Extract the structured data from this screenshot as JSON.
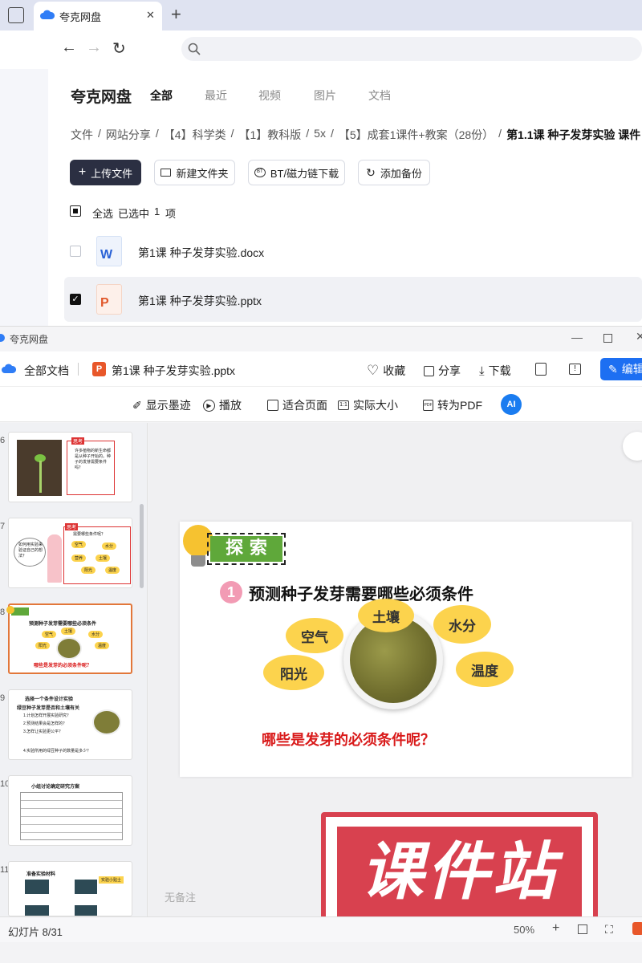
{
  "browser": {
    "tab_title": "夸克网盘",
    "close": "✕",
    "new_tab": "+"
  },
  "app": {
    "brand": "夸克网盘",
    "tabs": [
      "全部",
      "最近",
      "视频",
      "图片",
      "文档"
    ],
    "breadcrumb": [
      "文件",
      "网站分享",
      "【4】科学类",
      "【1】教科版",
      "5x",
      "【5】成套1课件+教案（28份）",
      "第1.1课 种子发芽实验 课件"
    ],
    "buttons": {
      "upload": "上传文件",
      "new_folder": "新建文件夹",
      "bt": "BT/磁力链下载",
      "backup": "添加备份"
    },
    "select_bar": {
      "select_all": "全选",
      "selected": "已选中",
      "count": "1",
      "unit": "项"
    },
    "files": [
      {
        "name": "第1课 种子发芽实验.docx",
        "type": "W",
        "checked": false
      },
      {
        "name": "第1课 种子发芽实验.pptx",
        "type": "P",
        "checked": true
      }
    ]
  },
  "viewer": {
    "window_title": "夸克网盘",
    "all_docs": "全部文档",
    "file_name": "第1课 种子发芽实验.pptx",
    "actions": [
      "收藏",
      "分享",
      "下载"
    ],
    "edit": "编辑",
    "toolbar": [
      "显示墨迹",
      "播放",
      "适合页面",
      "实际大小",
      "转为PDF"
    ],
    "ai_label": "AI",
    "thumb_numbers": [
      "6",
      "7",
      "8",
      "9",
      "10",
      "11"
    ],
    "thumb_texts": {
      "t6": "许多植物的新生命都是从种子开始的。种子的发芽需要条件吗？",
      "t6_tag": "思考",
      "t7_left": "如何用实验来验证自己的想法？",
      "t7_tag": "思考",
      "t7_q": "需要哪些条件呢？",
      "t7_words": [
        "空气",
        "水分",
        "营养",
        "土壤",
        "阳光",
        "温度"
      ],
      "t8_title": "预测种子发芽需要哪些必须条件",
      "t8_words": [
        "空气",
        "土壤",
        "水分",
        "阳光",
        "温度"
      ],
      "t8_bottom": "哪些是发芽的必须条件呢？",
      "t9_title": "选择一个条件设计实验",
      "t9_sub": "绿豆种子发芽是否和土壤有关",
      "t9_lines": [
        "1.计划怎样开展实验研究？",
        "2.预测结果会是怎样的？",
        "3.怎样让实验更公平？",
        "4.实验所用的绿豆种子的数量是多少？"
      ],
      "t10_title": "小组讨论确定研究方案",
      "t11_title": "准备实验材料",
      "t11_tag": "实验小贴士"
    },
    "slide": {
      "banner": "探 索",
      "num": "1",
      "title": "预测种子发芽需要哪些必须条件",
      "words": [
        "空气",
        "土壤",
        "水分",
        "阳光",
        "温度"
      ],
      "bottom": "哪些是发芽的必须条件呢？"
    },
    "no_notes": "无备注",
    "status": "幻灯片 8/31",
    "zoom": "50%",
    "watermark": "课件站"
  },
  "colors": {
    "accent": "#1d6ff2",
    "upload_btn": "#2b2f42",
    "banner": "#5fa83a",
    "title_red": "#d91b1b",
    "cloud": "#fcd34d",
    "watermark": "#d8414f"
  }
}
